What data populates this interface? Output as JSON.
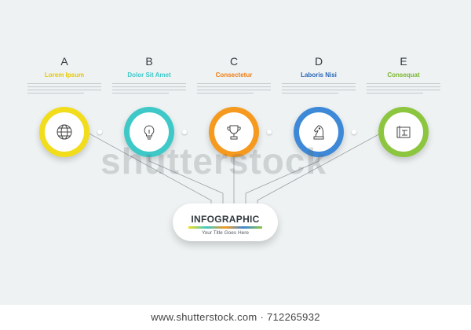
{
  "columns": [
    {
      "letter": "A",
      "label": "Lorem Ipsum",
      "color": "#f2dd1d",
      "icon": "globe-icon"
    },
    {
      "letter": "B",
      "label": "Dolor Sit Amet",
      "color": "#3ec9c8",
      "icon": "lightbulb-icon"
    },
    {
      "letter": "C",
      "label": "Consectetur",
      "color": "#f59a1f",
      "icon": "trophy-icon"
    },
    {
      "letter": "D",
      "label": "Laboris Nisi",
      "color": "#3d89d8",
      "icon": "chess-knight-icon"
    },
    {
      "letter": "E",
      "label": "Consequat",
      "color": "#8cc63f",
      "icon": "blueprint-icon"
    }
  ],
  "center": {
    "title": "INFOGRAPHIC",
    "subtitle": "Your Title Goes Here"
  },
  "watermark": "shutterstock",
  "footer": "www.shutterstock.com · 712265932"
}
